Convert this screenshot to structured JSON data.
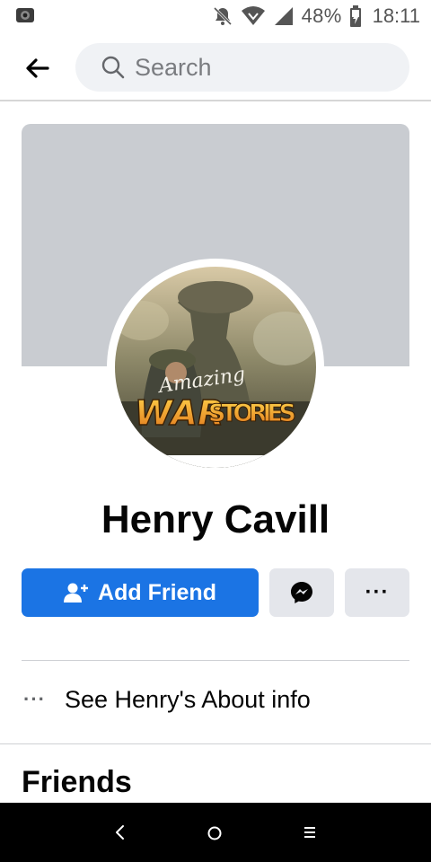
{
  "status_bar": {
    "battery": "48%",
    "time": "18:11"
  },
  "header": {
    "search_placeholder": "Search"
  },
  "profile": {
    "avatar_text_top": "Amazing",
    "avatar_text_war": "WAR",
    "avatar_text_stories": "STORIES",
    "name": "Henry Cavill"
  },
  "actions": {
    "add_friend_label": "Add Friend",
    "more_label": "···"
  },
  "about": {
    "dots": "···",
    "label": "See Henry's About info"
  },
  "sections": {
    "friends_heading": "Friends"
  },
  "colors": {
    "primary": "#1b74e4",
    "secondary_button": "#e4e6eb",
    "cover": "#c9ccd1"
  }
}
